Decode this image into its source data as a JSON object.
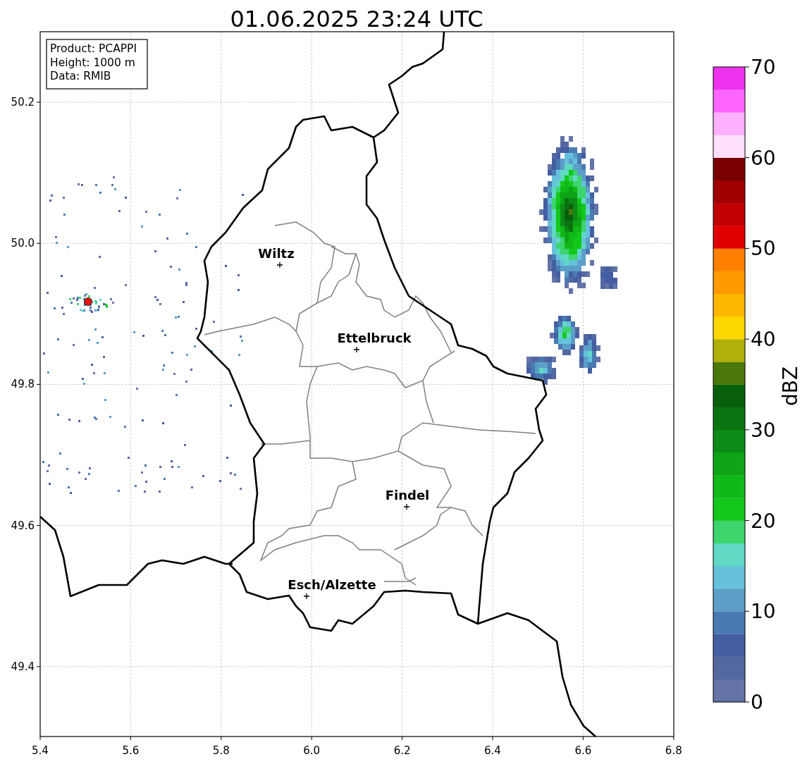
{
  "title": "01.06.2025 23:24 UTC",
  "info_box": [
    "Product: PCAPPI",
    "Height: 1000 m",
    "Data: RMIB"
  ],
  "x_ticks": [
    "5.4",
    "5.6",
    "5.8",
    "6.0",
    "6.2",
    "6.4",
    "6.6",
    "6.8"
  ],
  "y_ticks": [
    "50.2",
    "50.0",
    "49.8",
    "49.6",
    "49.4"
  ],
  "cities": [
    {
      "name": "Wiltz"
    },
    {
      "name": "Ettelbruck"
    },
    {
      "name": "Findel"
    },
    {
      "name": "Esch/Alzette"
    }
  ],
  "colorbar": {
    "label": "dBZ",
    "ticks": [
      "70",
      "60",
      "50",
      "40",
      "30",
      "20",
      "10",
      "0"
    ],
    "bins": [
      {
        "color": "#6474a8"
      },
      {
        "color": "#5468a0"
      },
      {
        "color": "#445ea2"
      },
      {
        "color": "#4a7ab2"
      },
      {
        "color": "#5b9ec8"
      },
      {
        "color": "#66c2dc"
      },
      {
        "color": "#60d8c4"
      },
      {
        "color": "#3dd46e"
      },
      {
        "color": "#12c81a"
      },
      {
        "color": "#10b818"
      },
      {
        "color": "#0ea416"
      },
      {
        "color": "#0c8c16"
      },
      {
        "color": "#0a7410"
      },
      {
        "color": "#075f0c"
      },
      {
        "color": "#4a7808"
      },
      {
        "color": "#b0b00a"
      },
      {
        "color": "#ffd700"
      },
      {
        "color": "#ffb800"
      },
      {
        "color": "#ff9b00"
      },
      {
        "color": "#ff7f00"
      },
      {
        "color": "#e00000"
      },
      {
        "color": "#c00000"
      },
      {
        "color": "#a00000"
      },
      {
        "color": "#780000"
      },
      {
        "color": "#ffe0ff"
      },
      {
        "color": "#ffb0ff"
      },
      {
        "color": "#ff66ff"
      },
      {
        "color": "#ee33ee"
      }
    ]
  }
}
